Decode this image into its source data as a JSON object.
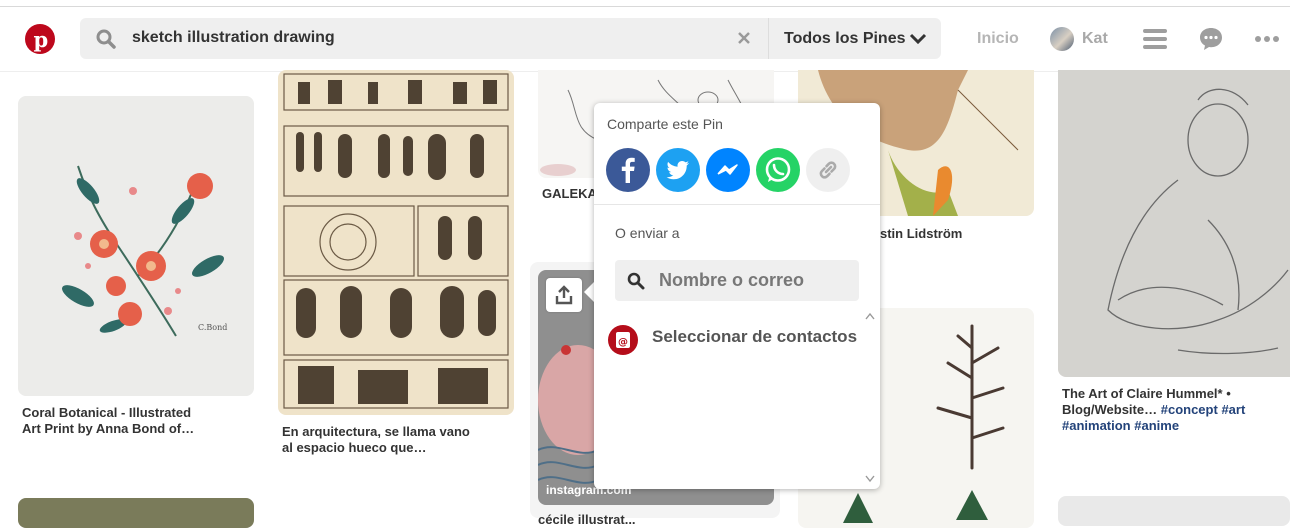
{
  "header": {
    "logo": "pinterest-logo-icon",
    "search_query": "sketch illustration drawing",
    "filter_label": "Todos los Pines",
    "nav_home": "Inicio",
    "user_name": "Kat",
    "icons": [
      "search-icon",
      "clear-icon",
      "chevron-down-icon",
      "menu-icon",
      "chat-icon",
      "more-icon"
    ]
  },
  "pins": [
    {
      "caption_1": "Coral Botanical - Illustrated",
      "caption_2": "Art Print by Anna Bond of…"
    },
    {
      "caption_1": "En arquitectura, se llama vano",
      "caption_2": "al espacio hueco que…"
    },
    {
      "caption_1": "GALEKA"
    },
    {
      "caption_1": "stin Lidström"
    },
    {
      "watermark": "instagram.com",
      "caption_1": "cécile illustrat..."
    },
    {
      "caption_1": "The Art of Claire Hummel* •",
      "caption_2": "Blog/Website…",
      "tag_1": "#concept",
      "tag_2": "#art",
      "tag_3": "#animation",
      "tag_4": "#anime"
    }
  ],
  "share_popup": {
    "title": "Comparte este Pin",
    "send_to_label": "O enviar a",
    "input_placeholder": "Nombre o correo",
    "select_contacts": "Seleccionar de contactos",
    "colors": {
      "facebook": "#3b5998",
      "twitter": "#1da1f2",
      "messenger": "#0084ff",
      "whatsapp": "#25d366",
      "link": "#efefef"
    }
  }
}
